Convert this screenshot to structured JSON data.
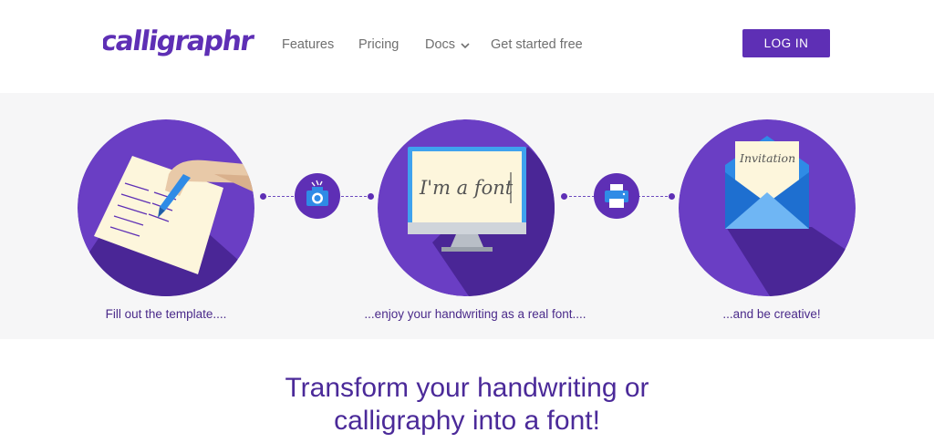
{
  "brand": {
    "name": "calligraphr",
    "color": "#5e2fb5"
  },
  "nav": {
    "items": [
      {
        "label": "Features"
      },
      {
        "label": "Pricing"
      },
      {
        "label": "Docs",
        "icon": "chevron-down-icon"
      },
      {
        "label": "Get started free"
      }
    ],
    "login_label": "LOG IN"
  },
  "steps": [
    {
      "caption": "Fill out the template....",
      "illustration": "hand-writing-on-template-icon"
    },
    {
      "caption": "...enjoy your handwriting as a real font....",
      "illustration": "monitor-icon",
      "screen_text": "I'm a font"
    },
    {
      "caption": "...and be creative!",
      "illustration": "envelope-icon",
      "card_text": "Invitation"
    }
  ],
  "connector_icons": [
    "camera-icon",
    "printer-icon"
  ],
  "headline": {
    "line1": "Transform your handwriting or",
    "line2": "calligraphy into a font!"
  },
  "colors": {
    "purple": "#5e2fb5",
    "circle": "#6a3ec4",
    "shadow": "#4a2696",
    "band_bg": "#f6f6f7",
    "headline": "#4b2a99",
    "accent_blue": "#2f8be6"
  }
}
